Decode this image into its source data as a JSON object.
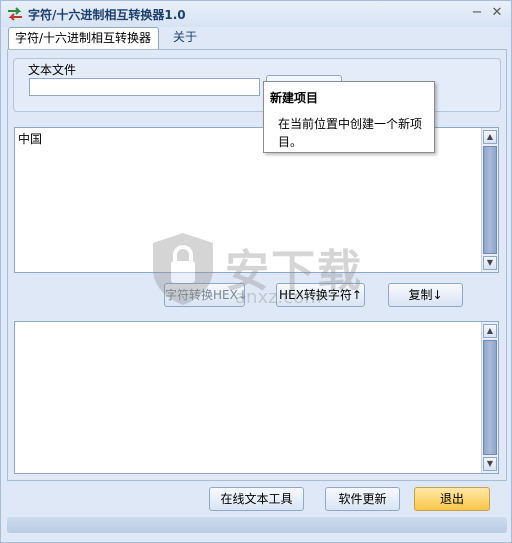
{
  "window": {
    "title": "字符/十六进制相互转换器1.0",
    "minimize_glyph": "−",
    "close_glyph": "✕"
  },
  "tabs": [
    {
      "label": "字符/十六进制相互转换器",
      "active": true
    },
    {
      "label": "关于",
      "active": false
    }
  ],
  "file_group": {
    "label": "文本文件",
    "input_value": ""
  },
  "input_text": "中国",
  "output_text": "",
  "buttons": {
    "char_to_hex": "字符转换HEX↓",
    "hex_to_char": "HEX转换字符↑",
    "copy": "复制↓",
    "online_tools": "在线文本工具",
    "update": "软件更新",
    "exit": "退出"
  },
  "tooltip": {
    "title": "新建项目",
    "body": "在当前位置中创建一个新项目。"
  },
  "watermark": {
    "text": "安下载",
    "domain": "anxz.com"
  },
  "colors": {
    "window_bg": "#dfe8f6",
    "title_text": "#1d3f6b",
    "exit_button": "#f9c64a",
    "scroll_thumb": "#8ea6c8"
  },
  "icons": {
    "app": "swap-arrows-icon",
    "scroll_up": "arrow-up-icon",
    "scroll_down": "arrow-down-icon",
    "watermark": "shield-icon"
  }
}
